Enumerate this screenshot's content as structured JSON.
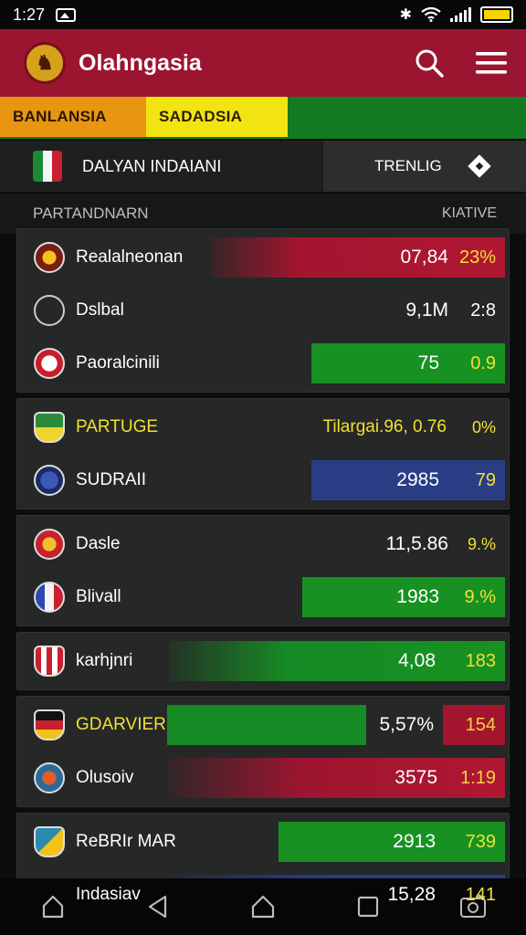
{
  "status": {
    "time": "1:27"
  },
  "header": {
    "title": "Olahngasia"
  },
  "tabs": [
    {
      "label": "BANLANSIA"
    },
    {
      "label": "SADADSIA"
    }
  ],
  "filter": {
    "league": "DALYAN INDAIANI",
    "trend_label": "TRENLIG"
  },
  "columns": {
    "left": "PARTANDNARN",
    "right": "KIATIVE"
  },
  "groups": [
    {
      "rows": [
        {
          "team": "Realalneonan",
          "value": "07,84",
          "pct": "23%"
        },
        {
          "team": "Dslbal",
          "value": "9,1M",
          "pct": "2:8"
        },
        {
          "team": "Paoralcinili",
          "value": "75",
          "pct": "0.9"
        }
      ]
    },
    {
      "rows": [
        {
          "team": "PARTUGE",
          "value": "Tilargai.96, 0.76",
          "pct": "0%"
        },
        {
          "team": "SUDRAII",
          "value": "2985",
          "pct": "79"
        }
      ]
    },
    {
      "rows": [
        {
          "team": "Dasle",
          "value": "11,5.86",
          "pct": "9.%"
        },
        {
          "team": "Blivall",
          "value": "1983",
          "pct": "9.%"
        }
      ]
    },
    {
      "rows": [
        {
          "team": "karhjnri",
          "value": "4,08",
          "pct": "183"
        }
      ]
    },
    {
      "rows": [
        {
          "team": "GDARVIER",
          "value": "5,57%",
          "pct": "154"
        },
        {
          "team": "Olusoiv",
          "value": "3575",
          "pct": "1:19"
        }
      ]
    },
    {
      "rows": [
        {
          "team": "ReBRIr MAR",
          "value": "2913",
          "pct": "739"
        },
        {
          "team": "Indasiav",
          "value": "15,28",
          "pct": "141"
        }
      ]
    }
  ]
}
